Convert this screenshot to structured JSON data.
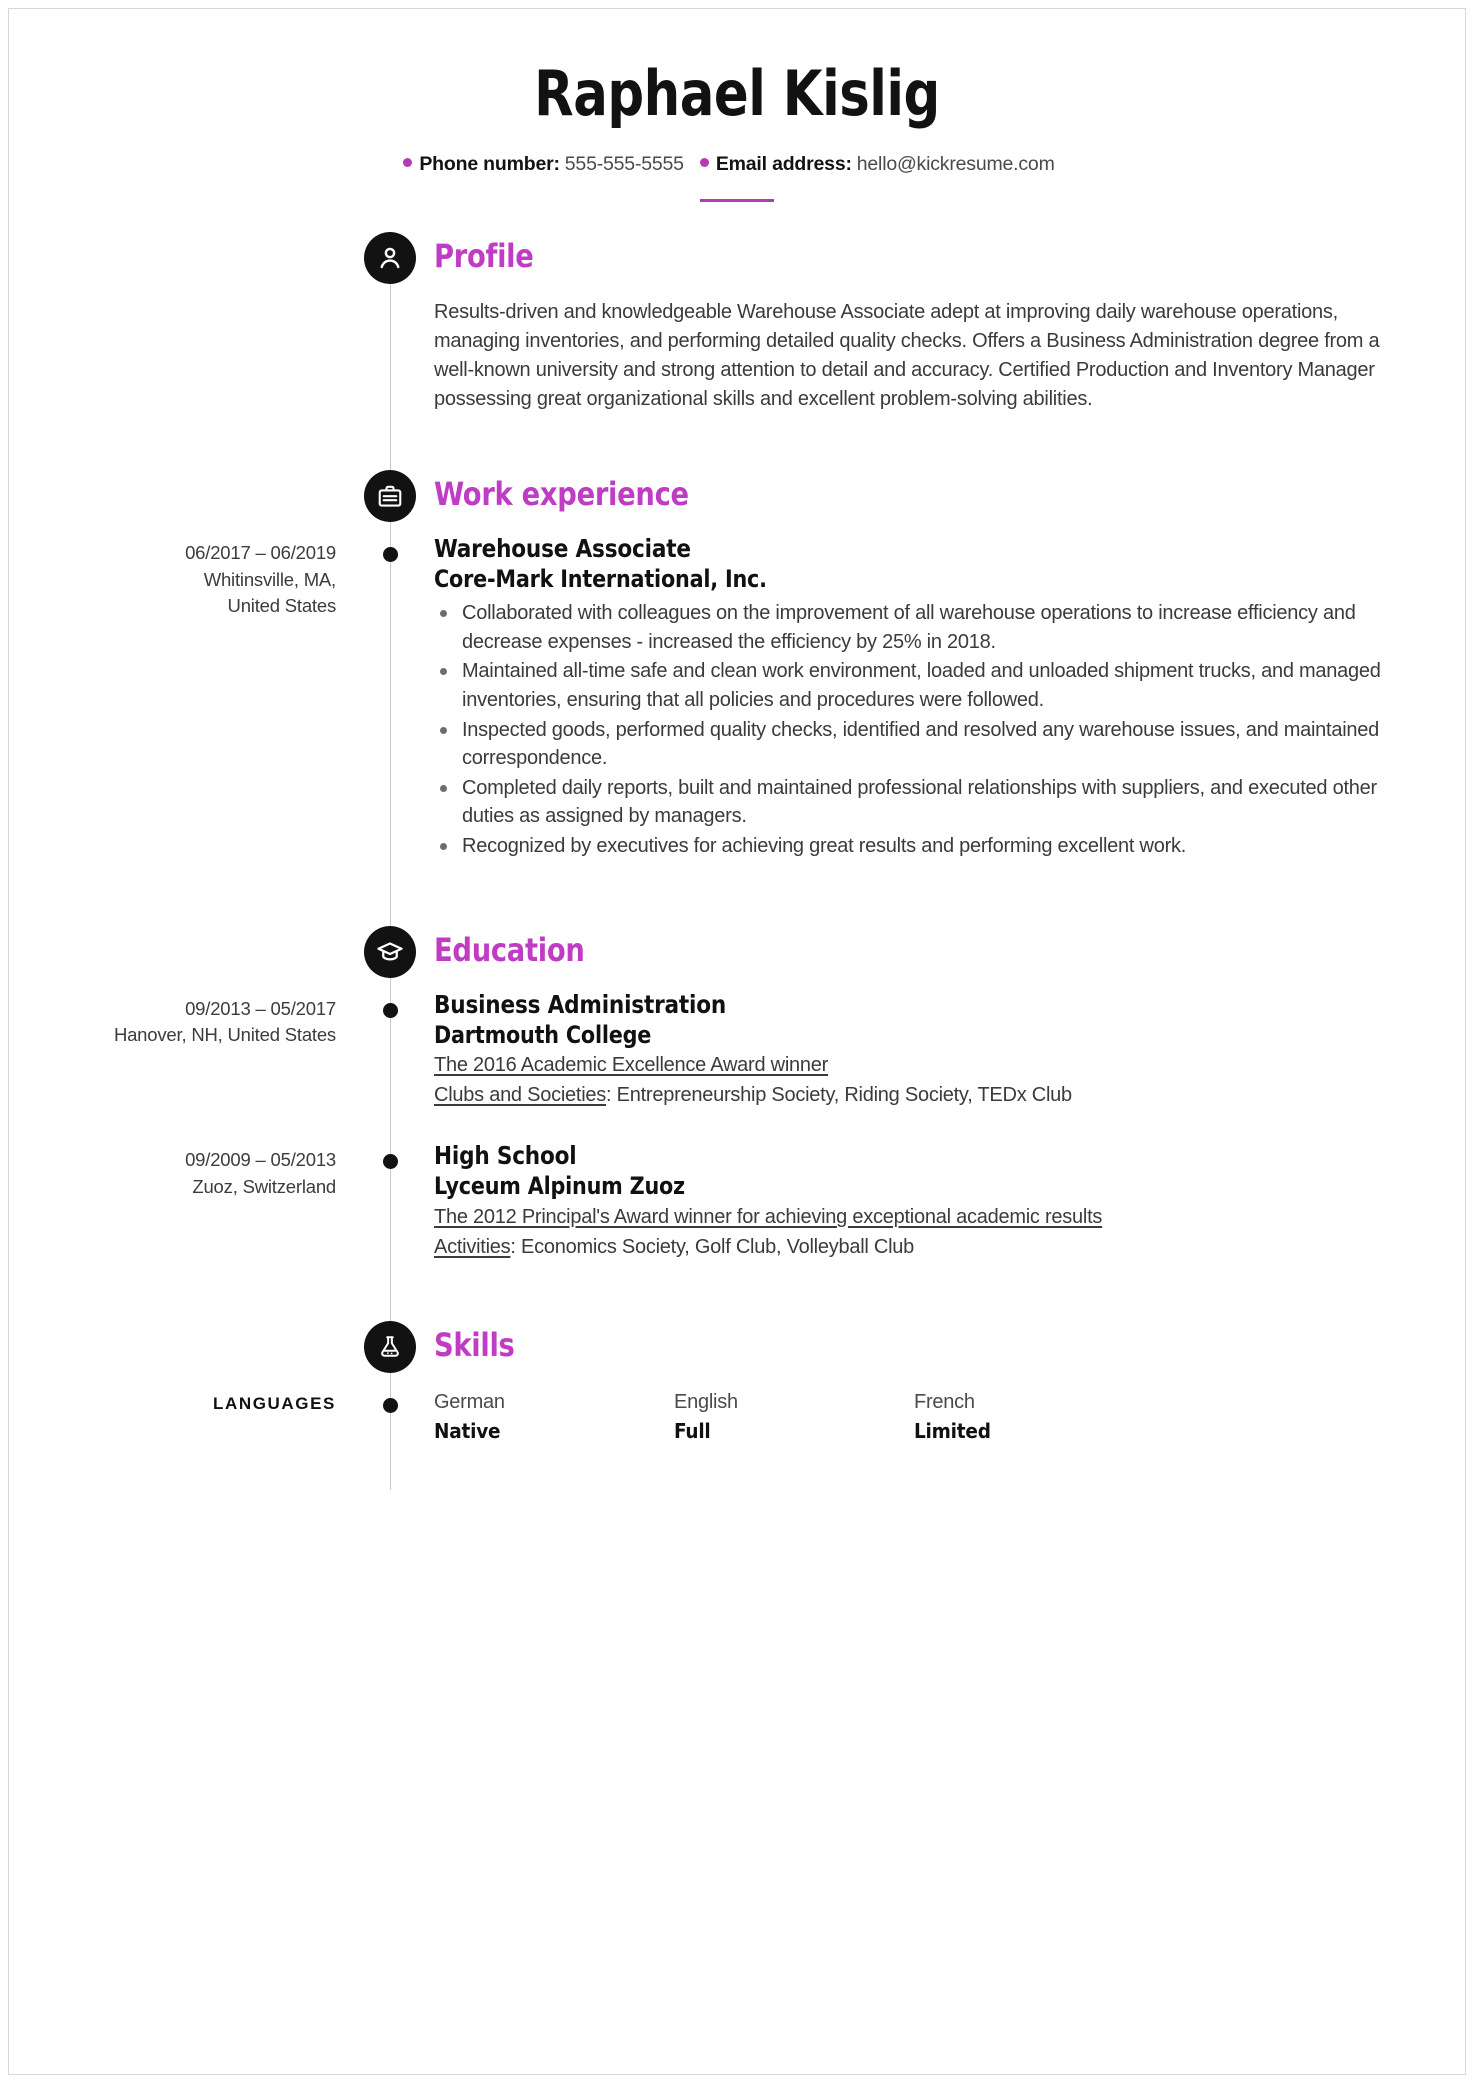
{
  "header": {
    "full_name": "Raphael Kislig",
    "phone_label": "Phone number:",
    "phone_value": "555-555-5555",
    "email_label": "Email address:",
    "email_value": "hello@kickresume.com",
    "accent_color": "#bf3cc4"
  },
  "sections": {
    "profile": {
      "title": "Profile",
      "icon": "person-icon",
      "text": "Results-driven and knowledgeable Warehouse Associate adept at improving daily warehouse operations, managing inventories, and performing detailed quality checks. Offers a Business Administration degree from a well-known university and strong attention to detail and accuracy. Certified Production and Inventory Manager possessing great organizational skills and excellent problem-solving abilities."
    },
    "work": {
      "title": "Work experience",
      "icon": "briefcase-icon",
      "entries": [
        {
          "dates": "06/2017 – 06/2019",
          "location_line1": "Whitinsville, MA,",
          "location_line2": "United States",
          "title": "Warehouse Associate",
          "company": "Core-Mark International, Inc.",
          "bullets": [
            "Collaborated with colleagues on the improvement of all warehouse operations to increase efficiency and decrease expenses - increased the efficiency by 25% in 2018.",
            "Maintained all-time safe and clean work environment, loaded and unloaded shipment trucks, and managed inventories, ensuring that all policies and procedures were followed.",
            "Inspected goods, performed quality checks, identified and resolved any warehouse issues, and maintained correspondence.",
            "Completed daily reports, built and maintained professional relationships with suppliers, and executed other duties as assigned by managers.",
            "Recognized by executives for achieving great results and performing excellent work."
          ]
        }
      ]
    },
    "education": {
      "title": "Education",
      "icon": "graduation-cap-icon",
      "entries": [
        {
          "dates": "09/2013 – 05/2017",
          "location_line1": "Hanover, NH, United States",
          "location_line2": "",
          "degree": "Business Administration",
          "school": "Dartmouth College",
          "note_award": "The 2016 Academic Excellence Award winner",
          "note_label": "Clubs and Societies",
          "note_value": ": Entrepreneurship Society, Riding Society, TEDx Club"
        },
        {
          "dates": "09/2009 – 05/2013",
          "location_line1": "Zuoz, Switzerland",
          "location_line2": "",
          "degree": "High School",
          "school": "Lyceum Alpinum Zuoz",
          "note_award": "The 2012 Principal's Award winner for achieving exceptional academic results",
          "note_label": "Activities",
          "note_value": ": Economics Society, Golf Club, Volleyball Club"
        }
      ]
    },
    "skills": {
      "title": "Skills",
      "icon": "flask-icon",
      "group_label": "LANGUAGES",
      "languages": [
        {
          "name": "German",
          "level": "Native"
        },
        {
          "name": "English",
          "level": "Full"
        },
        {
          "name": "French",
          "level": "Limited"
        }
      ]
    }
  }
}
